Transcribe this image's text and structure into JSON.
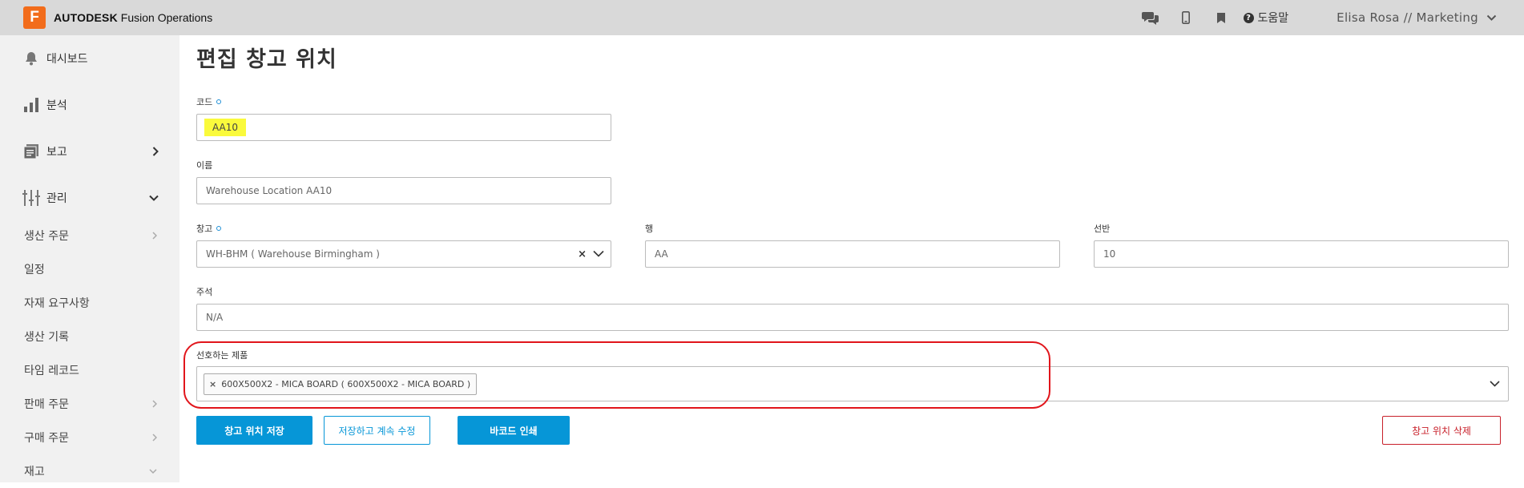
{
  "header": {
    "logo_letter": "F",
    "brand": "AUTODESK",
    "product": "Fusion Operations",
    "icons": [
      "chat-icon",
      "mobile-icon",
      "bookmark-icon"
    ],
    "help_label": "도움말",
    "user_label": "Elisa Rosa // Marketing"
  },
  "sidebar": {
    "main_items": [
      {
        "label": "대시보드",
        "icon": "bell-icon"
      },
      {
        "label": "분석",
        "icon": "bar-chart-icon"
      },
      {
        "label": "보고",
        "icon": "report-icon"
      },
      {
        "label": "관리",
        "icon": "sliders-icon"
      }
    ],
    "sub_items": [
      {
        "label": "생산 주문"
      },
      {
        "label": "일정"
      },
      {
        "label": "자재 요구사항"
      },
      {
        "label": "생산 기록"
      },
      {
        "label": "타임 레코드"
      },
      {
        "label": "판매 주문"
      },
      {
        "label": "구매 주문"
      },
      {
        "label": "재고"
      }
    ]
  },
  "form": {
    "title": "편집 창고 위치",
    "code": {
      "label": "코드",
      "value": "AA10"
    },
    "name": {
      "label": "이름",
      "value": "Warehouse Location AA10"
    },
    "warehouse": {
      "label": "창고",
      "value": "WH-BHM ( Warehouse Birmingham )",
      "clear": "×"
    },
    "row": {
      "label": "행",
      "value": "AA"
    },
    "shelf": {
      "label": "선반",
      "value": "10"
    },
    "notes": {
      "label": "주석",
      "value": "N/A"
    },
    "preferred": {
      "label": "선호하는 제품",
      "tags": [
        {
          "remove": "×",
          "text": "600X500X2 - MICA BOARD ( 600X500X2 - MICA BOARD )"
        }
      ]
    }
  },
  "actions": {
    "save": "창고 위치 저장",
    "save_continue": "저장하고 계속 수정",
    "print_barcode": "바코드 인쇄",
    "delete": "창고 위치 삭제"
  },
  "colors": {
    "accent": "#0696d7",
    "danger": "#c8202a",
    "brand": "#f26c1b",
    "highlight": "#fafa3c",
    "annotation": "#e1151b"
  }
}
